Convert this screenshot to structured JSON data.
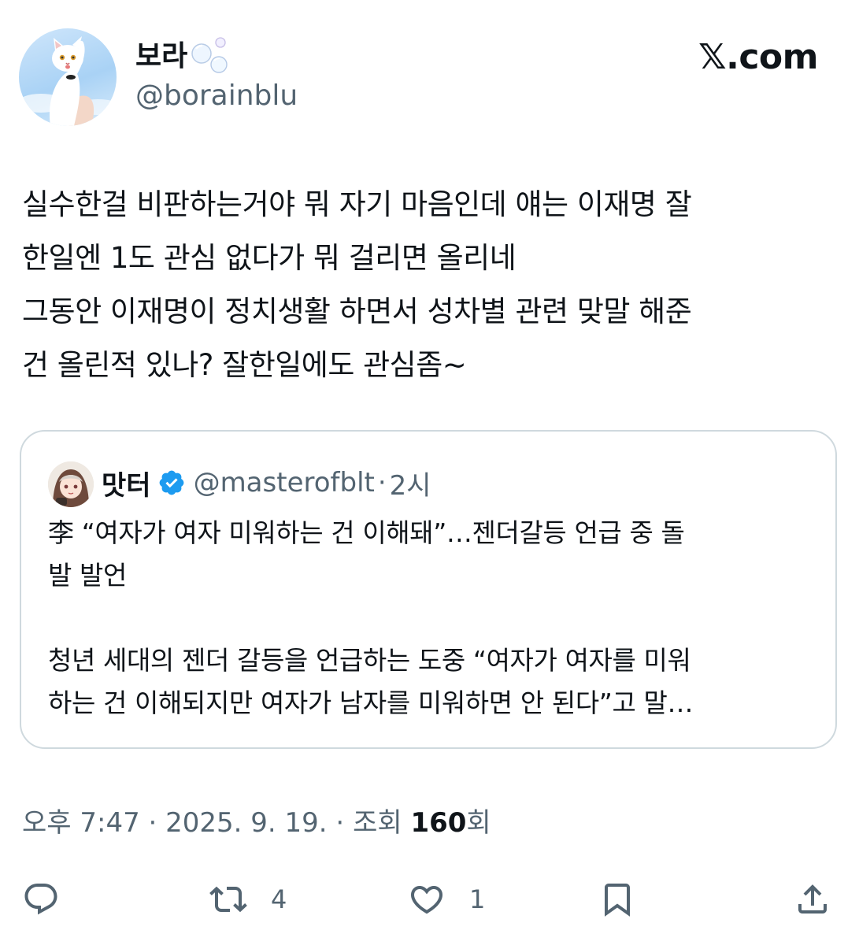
{
  "author": {
    "display_name": "보라",
    "handle": "@borainblu",
    "name_emoji": "bubbles-emoji",
    "avatar": "white-cat-avatar"
  },
  "site_logo": "𝕏.com",
  "tweet": {
    "lines": [
      "실수한걸 비판하는거야 뭐 자기 마음인데 얘는 이재명 잘",
      "한일엔 1도 관심 없다가 뭐 걸리면 올리네",
      "그동안 이재명이 정치생활 하면서 성차별 관련 맞말 해준",
      "건 올린적 있나? 잘한일에도 관심좀~"
    ]
  },
  "quote": {
    "display_name": "맛터",
    "verified_icon": "verified-badge-icon",
    "handle": "@masterofblt",
    "separator": "·",
    "time": "2시",
    "headline_lines": [
      "李 “여자가 여자 미워하는 건 이해돼”…젠더갈등 언급 중 돌",
      "발 발언"
    ],
    "body_lines": [
      "청년 세대의 젠더 갈등을 언급하는 도중 “여자가 여자를 미워",
      "하는 건 이해되지만 여자가 남자를 미워하면 안 된다”고 말…"
    ]
  },
  "meta": {
    "time": "오후 7:47",
    "dot1": " · ",
    "date": "2025. 9. 19.",
    "dot2": " · ",
    "views_prefix": "조회 ",
    "views_count": "160",
    "views_suffix": "회"
  },
  "actions": {
    "reply": {
      "icon": "reply-icon",
      "count": ""
    },
    "retweet": {
      "icon": "retweet-icon",
      "count": "4"
    },
    "like": {
      "icon": "heart-icon",
      "count": "1"
    },
    "bookmark": {
      "icon": "bookmark-icon",
      "count": ""
    },
    "share": {
      "icon": "share-icon",
      "count": ""
    }
  },
  "colors": {
    "text": "#0f1419",
    "secondary": "#536471",
    "border": "#cfd9de",
    "verified": "#1d9bf0"
  }
}
